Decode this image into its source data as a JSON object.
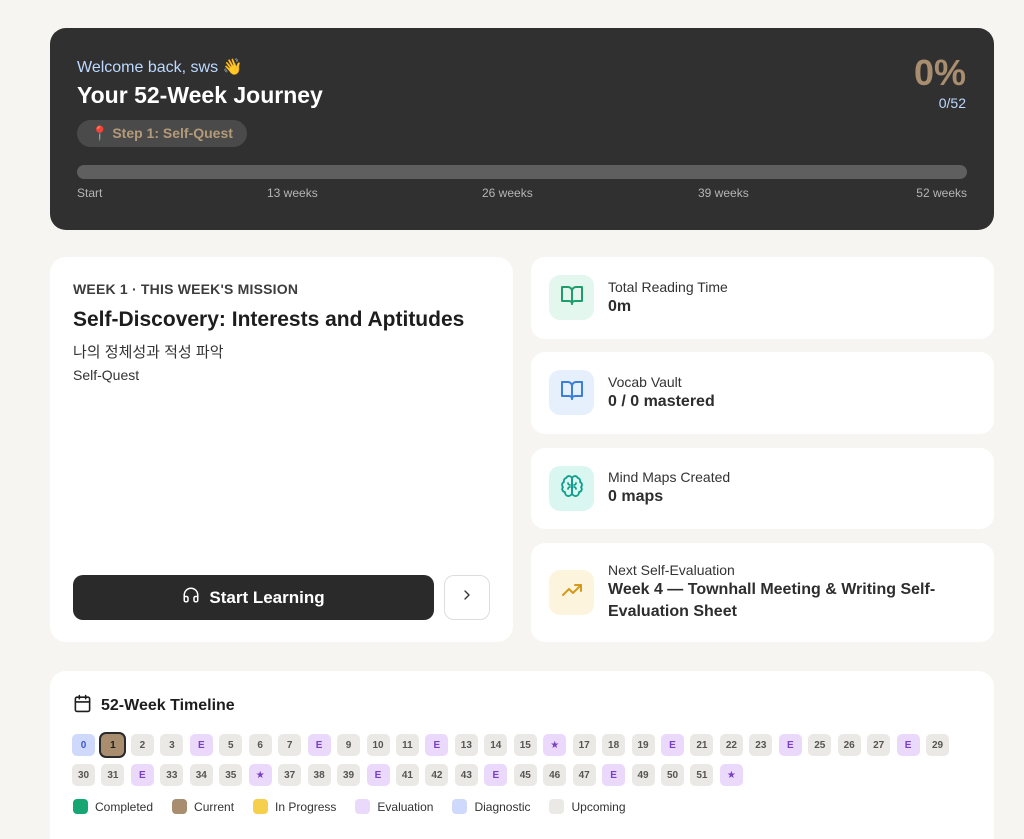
{
  "hero": {
    "welcome": "Welcome back, sws 👋",
    "title": "Your 52-Week Journey",
    "step": "📍 Step 1: Self-Quest",
    "percent": "0%",
    "count": "0/52",
    "progress_fraction": 0,
    "ticks": [
      "Start",
      "13 weeks",
      "26 weeks",
      "39 weeks",
      "52 weeks"
    ]
  },
  "mission": {
    "eyebrow": "WEEK 1 · THIS WEEK'S MISSION",
    "title": "Self-Discovery: Interests and Aptitudes",
    "subtitle_ko": "나의 정체성과 적성 파악",
    "tag": "Self-Quest",
    "start_label": "Start Learning"
  },
  "stats": [
    {
      "label": "Total Reading Time",
      "value": "0m",
      "icon": "open-book-icon",
      "color": "#1f9d6b",
      "bg": "#e3f7ee"
    },
    {
      "label": "Vocab Vault",
      "value": "0 / 0 mastered",
      "icon": "open-book-icon",
      "color": "#3b7fd9",
      "bg": "#e6effc"
    },
    {
      "label": "Mind Maps Created",
      "value": "0 maps",
      "icon": "brain-icon",
      "color": "#119e8f",
      "bg": "#d9f6f1"
    },
    {
      "label": "Next Self-Evaluation",
      "value": "Week 4 — Townhall Meeting & Writing Self-Evaluation Sheet",
      "icon": "trending-up-icon",
      "color": "#d49a1c",
      "bg": "#fdf4de"
    }
  ],
  "timeline": {
    "title": "52-Week Timeline",
    "weeks": [
      {
        "label": "0",
        "status": "diagnostic"
      },
      {
        "label": "1",
        "status": "current"
      },
      {
        "label": "2",
        "status": "upcoming"
      },
      {
        "label": "3",
        "status": "upcoming"
      },
      {
        "label": "E",
        "status": "evaluation"
      },
      {
        "label": "5",
        "status": "upcoming"
      },
      {
        "label": "6",
        "status": "upcoming"
      },
      {
        "label": "7",
        "status": "upcoming"
      },
      {
        "label": "E",
        "status": "evaluation"
      },
      {
        "label": "9",
        "status": "upcoming"
      },
      {
        "label": "10",
        "status": "upcoming"
      },
      {
        "label": "11",
        "status": "upcoming"
      },
      {
        "label": "E",
        "status": "evaluation"
      },
      {
        "label": "13",
        "status": "upcoming"
      },
      {
        "label": "14",
        "status": "upcoming"
      },
      {
        "label": "15",
        "status": "upcoming"
      },
      {
        "label": "★",
        "status": "milestone"
      },
      {
        "label": "17",
        "status": "upcoming"
      },
      {
        "label": "18",
        "status": "upcoming"
      },
      {
        "label": "19",
        "status": "upcoming"
      },
      {
        "label": "E",
        "status": "evaluation"
      },
      {
        "label": "21",
        "status": "upcoming"
      },
      {
        "label": "22",
        "status": "upcoming"
      },
      {
        "label": "23",
        "status": "upcoming"
      },
      {
        "label": "E",
        "status": "evaluation"
      },
      {
        "label": "25",
        "status": "upcoming"
      },
      {
        "label": "26",
        "status": "upcoming"
      },
      {
        "label": "27",
        "status": "upcoming"
      },
      {
        "label": "E",
        "status": "evaluation"
      },
      {
        "label": "29",
        "status": "upcoming"
      },
      {
        "label": "30",
        "status": "upcoming"
      },
      {
        "label": "31",
        "status": "upcoming"
      },
      {
        "label": "E",
        "status": "evaluation"
      },
      {
        "label": "33",
        "status": "upcoming"
      },
      {
        "label": "34",
        "status": "upcoming"
      },
      {
        "label": "35",
        "status": "upcoming"
      },
      {
        "label": "★",
        "status": "milestone"
      },
      {
        "label": "37",
        "status": "upcoming"
      },
      {
        "label": "38",
        "status": "upcoming"
      },
      {
        "label": "39",
        "status": "upcoming"
      },
      {
        "label": "E",
        "status": "evaluation"
      },
      {
        "label": "41",
        "status": "upcoming"
      },
      {
        "label": "42",
        "status": "upcoming"
      },
      {
        "label": "43",
        "status": "upcoming"
      },
      {
        "label": "E",
        "status": "evaluation"
      },
      {
        "label": "45",
        "status": "upcoming"
      },
      {
        "label": "46",
        "status": "upcoming"
      },
      {
        "label": "47",
        "status": "upcoming"
      },
      {
        "label": "E",
        "status": "evaluation"
      },
      {
        "label": "49",
        "status": "upcoming"
      },
      {
        "label": "50",
        "status": "upcoming"
      },
      {
        "label": "51",
        "status": "upcoming"
      },
      {
        "label": "★",
        "status": "milestone"
      }
    ],
    "legend": [
      {
        "label": "Completed",
        "color": "#17a673"
      },
      {
        "label": "Current",
        "color": "#a88d6e"
      },
      {
        "label": "In Progress",
        "color": "#f6d04d"
      },
      {
        "label": "Evaluation",
        "color": "#ead9fb"
      },
      {
        "label": "Diagnostic",
        "color": "#cfd9fb"
      },
      {
        "label": "Upcoming",
        "color": "#ebe9e5"
      }
    ]
  }
}
